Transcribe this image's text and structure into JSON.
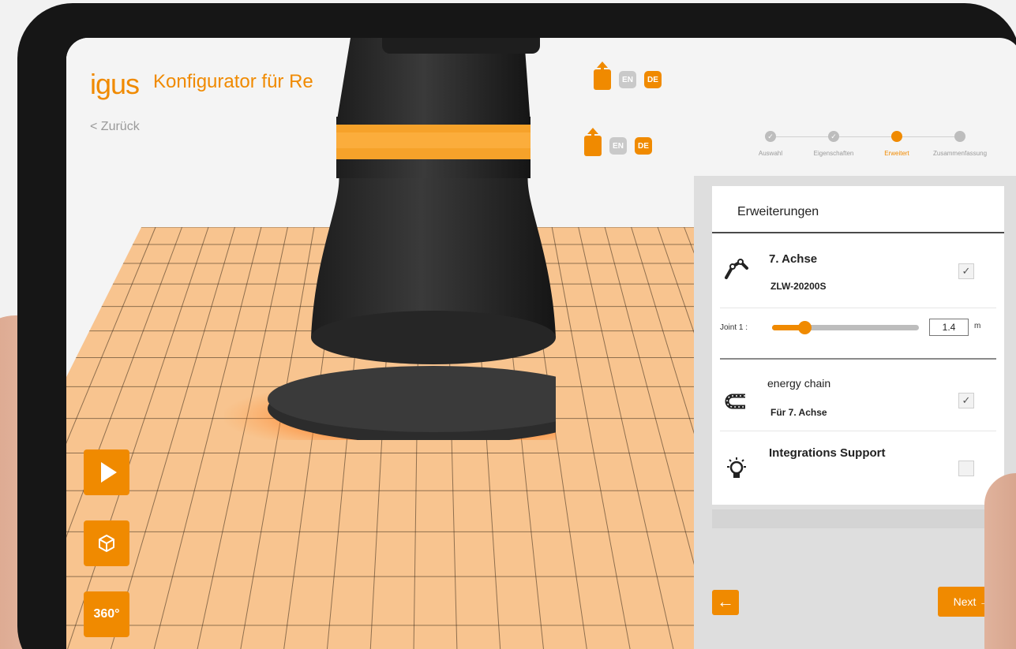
{
  "header": {
    "logo": "igus",
    "title": "Konfigurator für Re",
    "back_label": "< Zurück"
  },
  "languages": {
    "en": "EN",
    "de": "DE"
  },
  "stepper": [
    {
      "label": "Auswahl",
      "state": "done"
    },
    {
      "label": "Eigenschaften",
      "state": "done"
    },
    {
      "label": "Erweitert",
      "state": "active"
    },
    {
      "label": "Zusammenfassung",
      "state": "todo"
    }
  ],
  "panel": {
    "title": "Erweiterungen",
    "items": [
      {
        "name": "7. Achse",
        "sub": "ZLW-20200S",
        "checked": true,
        "icon": "robot-arm-icon"
      },
      {
        "name": "energy chain",
        "sub": "Für 7. Achse",
        "checked": true,
        "icon": "energy-chain-icon"
      },
      {
        "name": "Integrations Support",
        "sub": "",
        "checked": false,
        "icon": "lightbulb-icon"
      }
    ],
    "joint": {
      "label": "Joint 1 :",
      "value": "1.4",
      "unit": "m",
      "fraction": 0.22
    },
    "check_mark": "✓"
  },
  "nav": {
    "back_icon": "arrow-left-icon",
    "next_label": "Next →"
  },
  "tools": [
    {
      "name": "play-icon"
    },
    {
      "name": "cube-icon"
    },
    {
      "name": "rotate-360-icon",
      "label": "360°"
    }
  ],
  "colors": {
    "accent": "#f08a00",
    "floor": "#f8c48f",
    "grid": "#3a2a1a"
  }
}
